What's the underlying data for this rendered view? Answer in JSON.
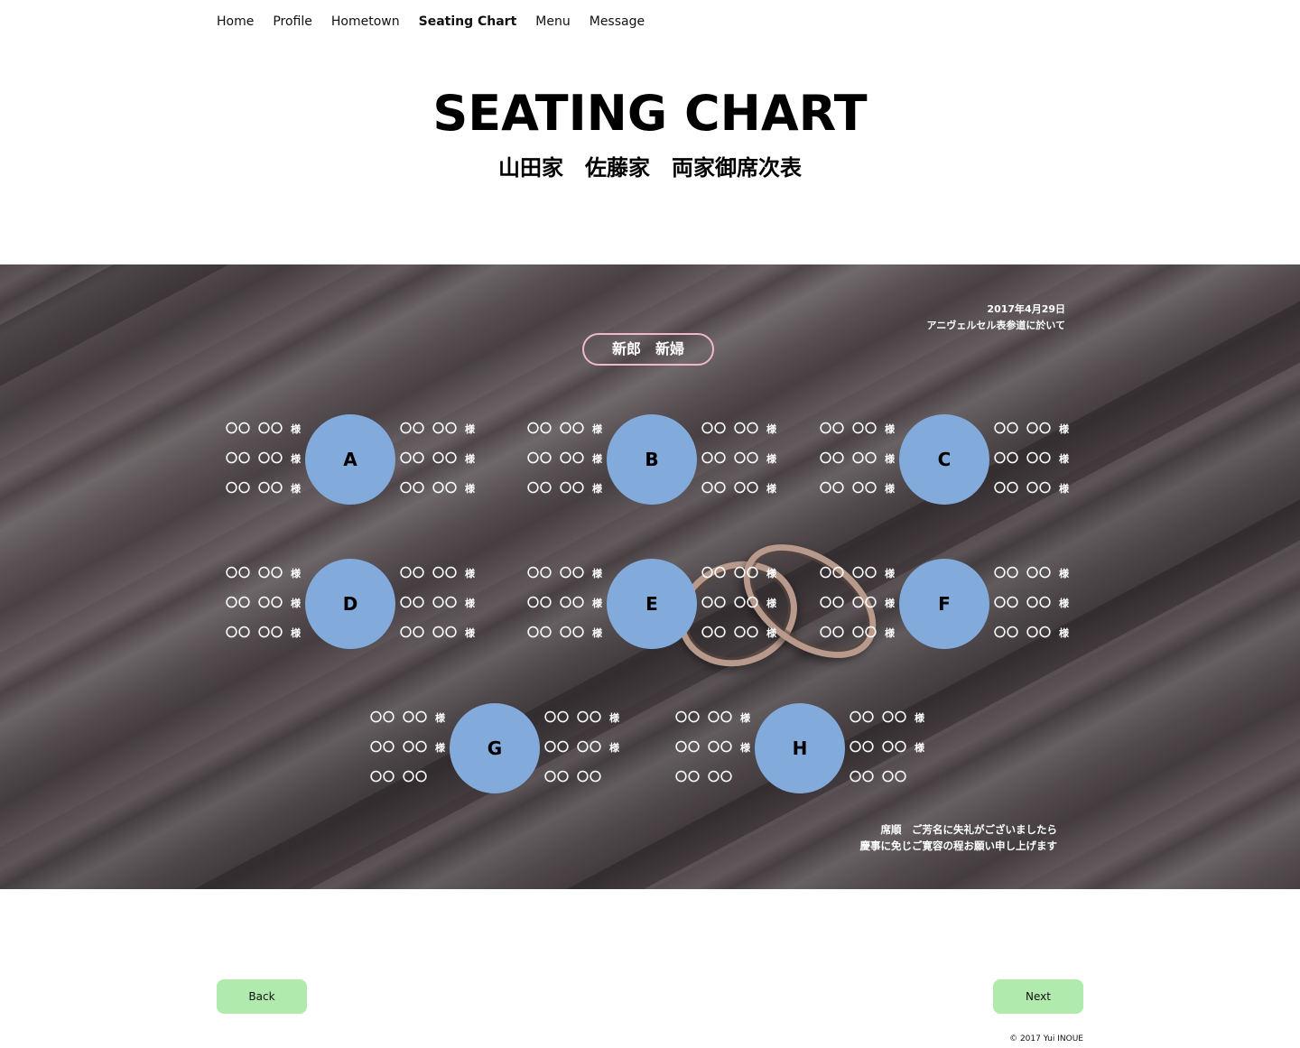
{
  "nav": {
    "items": [
      {
        "label": "Home"
      },
      {
        "label": "Profile"
      },
      {
        "label": "Hometown"
      },
      {
        "label": "Seating Chart",
        "active": true
      },
      {
        "label": "Menu"
      },
      {
        "label": "Message"
      }
    ]
  },
  "header": {
    "title": "SEATING CHART",
    "subtitle": "山田家　佐藤家　両家御席次表"
  },
  "chart": {
    "date": "2017年4月29日",
    "venue": "アニヴェルセル表参道に於いて",
    "couple": "新郎　新婦",
    "tables": [
      {
        "label": "A",
        "left": [
          [
            "〇〇",
            "〇〇",
            "様"
          ],
          [
            "〇〇",
            "〇〇",
            "様"
          ],
          [
            "〇〇",
            "〇〇",
            "様"
          ]
        ],
        "right": [
          [
            "〇〇",
            "〇〇",
            "様"
          ],
          [
            "〇〇",
            "〇〇",
            "様"
          ],
          [
            "〇〇",
            "〇〇",
            "様"
          ]
        ]
      },
      {
        "label": "B",
        "left": [
          [
            "〇〇",
            "〇〇",
            "様"
          ],
          [
            "〇〇",
            "〇〇",
            "様"
          ],
          [
            "〇〇",
            "〇〇",
            "様"
          ]
        ],
        "right": [
          [
            "〇〇",
            "〇〇",
            "様"
          ],
          [
            "〇〇",
            "〇〇",
            "様"
          ],
          [
            "〇〇",
            "〇〇",
            "様"
          ]
        ]
      },
      {
        "label": "C",
        "left": [
          [
            "〇〇",
            "〇〇",
            "様"
          ],
          [
            "〇〇",
            "〇〇",
            "様"
          ],
          [
            "〇〇",
            "〇〇",
            "様"
          ]
        ],
        "right": [
          [
            "〇〇",
            "〇〇",
            "様"
          ],
          [
            "〇〇",
            "〇〇",
            "様"
          ],
          [
            "〇〇",
            "〇〇",
            "様"
          ]
        ]
      },
      {
        "label": "D",
        "left": [
          [
            "〇〇",
            "〇〇",
            "様"
          ],
          [
            "〇〇",
            "〇〇",
            "様"
          ],
          [
            "〇〇",
            "〇〇",
            "様"
          ]
        ],
        "right": [
          [
            "〇〇",
            "〇〇",
            "様"
          ],
          [
            "〇〇",
            "〇〇",
            "様"
          ],
          [
            "〇〇",
            "〇〇",
            "様"
          ]
        ]
      },
      {
        "label": "E",
        "left": [
          [
            "〇〇",
            "〇〇",
            "様"
          ],
          [
            "〇〇",
            "〇〇",
            "様"
          ],
          [
            "〇〇",
            "〇〇",
            "様"
          ]
        ],
        "right": [
          [
            "〇〇",
            "〇〇",
            "様"
          ],
          [
            "〇〇",
            "〇〇",
            "様"
          ],
          [
            "〇〇",
            "〇〇",
            "様"
          ]
        ]
      },
      {
        "label": "F",
        "left": [
          [
            "〇〇",
            "〇〇",
            "様"
          ],
          [
            "〇〇",
            "〇〇",
            "様"
          ],
          [
            "〇〇",
            "〇〇",
            "様"
          ]
        ],
        "right": [
          [
            "〇〇",
            "〇〇",
            "様"
          ],
          [
            "〇〇",
            "〇〇",
            "様"
          ],
          [
            "〇〇",
            "〇〇",
            "様"
          ]
        ]
      },
      {
        "label": "G",
        "left": [
          [
            "〇〇",
            "〇〇",
            "様"
          ],
          [
            "〇〇",
            "〇〇",
            "様"
          ],
          [
            "〇〇",
            "〇〇",
            ""
          ]
        ],
        "right": [
          [
            "〇〇",
            "〇〇",
            "様"
          ],
          [
            "〇〇",
            "〇〇",
            "様"
          ],
          [
            "〇〇",
            "〇〇",
            ""
          ]
        ]
      },
      {
        "label": "H",
        "left": [
          [
            "〇〇",
            "〇〇",
            "様"
          ],
          [
            "〇〇",
            "〇〇",
            "様"
          ],
          [
            "〇〇",
            "〇〇",
            ""
          ]
        ],
        "right": [
          [
            "〇〇",
            "〇〇",
            "様"
          ],
          [
            "〇〇",
            "〇〇",
            "様"
          ],
          [
            "〇〇",
            "〇〇",
            ""
          ]
        ]
      }
    ],
    "footnote_line1": "席順　ご芳名に失礼がございましたら",
    "footnote_line2": "慶事に免じご寛容の程お願い申し上げます"
  },
  "buttons": {
    "back": "Back",
    "next": "Next"
  },
  "footer": {
    "copyright": "© 2017 Yui INOUE"
  },
  "colors": {
    "table_circle": "#82abdb",
    "button_bg": "#b1eaad",
    "couple_border": "#f0b8c8"
  }
}
